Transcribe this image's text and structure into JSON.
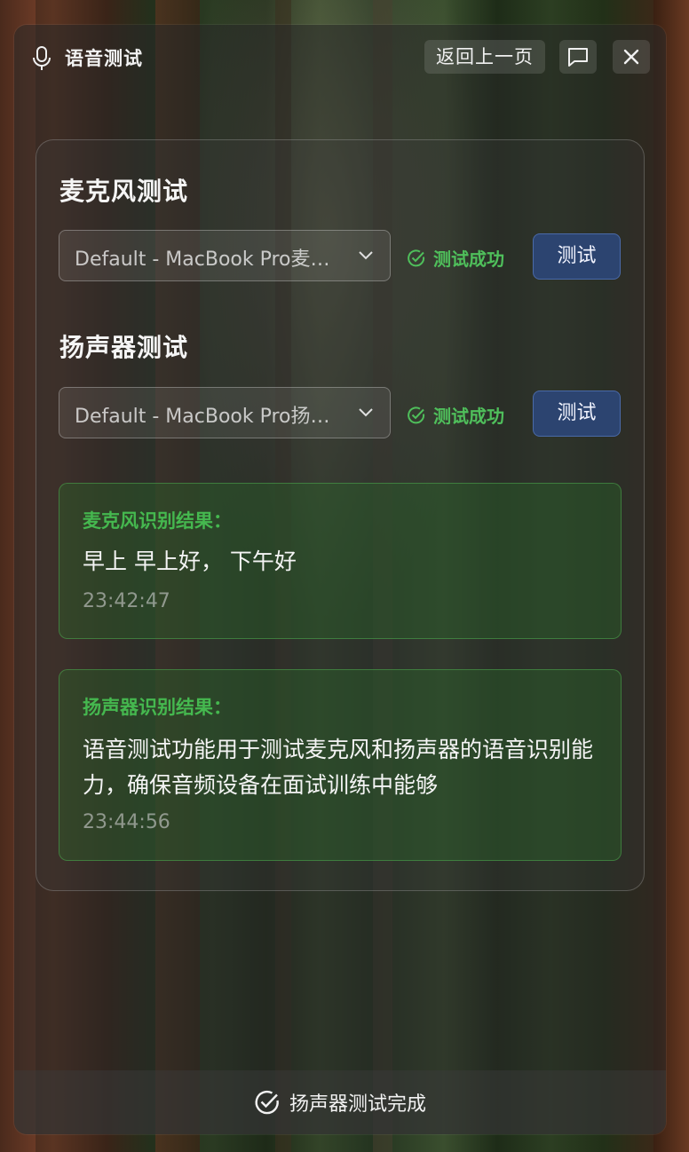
{
  "window": {
    "title": "语音测试",
    "back_label": "返回上一页",
    "icons": {
      "title": "microphone-icon",
      "feedback": "message-square-icon",
      "close": "close-icon"
    }
  },
  "microphone": {
    "section_title": "麦克风测试",
    "device_selected": "Default - MacBook Pro麦克风",
    "status": "测试成功",
    "test_button": "测试"
  },
  "speaker": {
    "section_title": "扬声器测试",
    "device_selected": "Default - MacBook Pro扬声器",
    "status": "测试成功",
    "test_button": "测试"
  },
  "mic_result": {
    "label": "麦克风识别结果：",
    "text": "早上 早上好， 下午好",
    "time": "23:42:47"
  },
  "speaker_result": {
    "label": "扬声器识别结果：",
    "text": "语音测试功能用于测试麦克风和扬声器的语音识别能力，确保音频设备在面试训练中能够",
    "time": "23:44:56"
  },
  "footer": {
    "message": "扬声器测试完成",
    "icon": "check-circle-icon"
  },
  "colors": {
    "success": "#4fbf5b",
    "accent": "#2c4470"
  }
}
